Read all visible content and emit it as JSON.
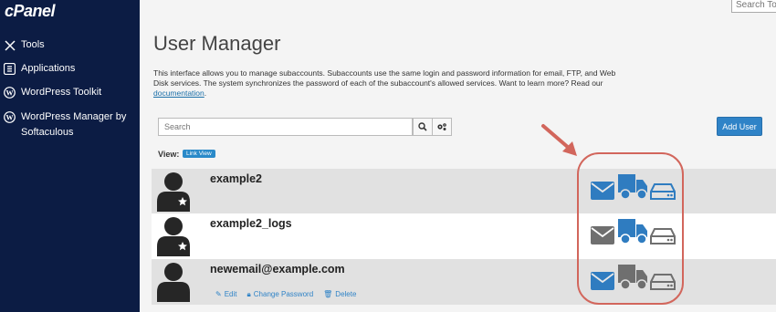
{
  "brand": {
    "logo_text": "cPanel"
  },
  "sidebar": {
    "items": [
      {
        "label": "Tools",
        "icon": "tools-icon"
      },
      {
        "label": "Applications",
        "icon": "applications-icon"
      },
      {
        "label": "WordPress Toolkit",
        "icon": "wordpress-icon"
      },
      {
        "label": "WordPress Manager by Softaculous",
        "icon": "wordpress-icon"
      }
    ]
  },
  "header": {
    "search_placeholder": "Search Tools"
  },
  "page": {
    "title": "User Manager",
    "intro_text": "This interface allows you to manage subaccounts. Subaccounts use the same login and password information for email, FTP, and Web Disk services. The system synchronizes the password of each of the subaccount's allowed services. Want to learn more? Read our ",
    "intro_link": "documentation",
    "intro_end": "."
  },
  "toolbar": {
    "search_placeholder": "Search",
    "search_icon": "magnifier-icon",
    "settings_icon": "gears-icon",
    "add_user_label": "Add User"
  },
  "view": {
    "label": "View:",
    "mode": "Link View"
  },
  "users": [
    {
      "name": "example2",
      "services": {
        "email": "enabled",
        "ftp": "enabled",
        "webdisk": "enabled"
      },
      "badge": "star"
    },
    {
      "name": "example2_logs",
      "services": {
        "email": "disabled",
        "ftp": "enabled",
        "webdisk": "disabled"
      },
      "badge": "star"
    },
    {
      "name": "newemail@example.com",
      "services": {
        "email": "enabled",
        "ftp": "disabled",
        "webdisk": "disabled"
      },
      "badge": "none",
      "actions": {
        "edit": "Edit",
        "change_password": "Change Password",
        "delete": "Delete"
      }
    }
  ],
  "colors": {
    "sidebar_bg": "#0c1c44",
    "enabled": "#2f7cc0",
    "disabled": "#6f6f6f",
    "highlight": "#d2665c",
    "accent": "#2f83c7"
  }
}
